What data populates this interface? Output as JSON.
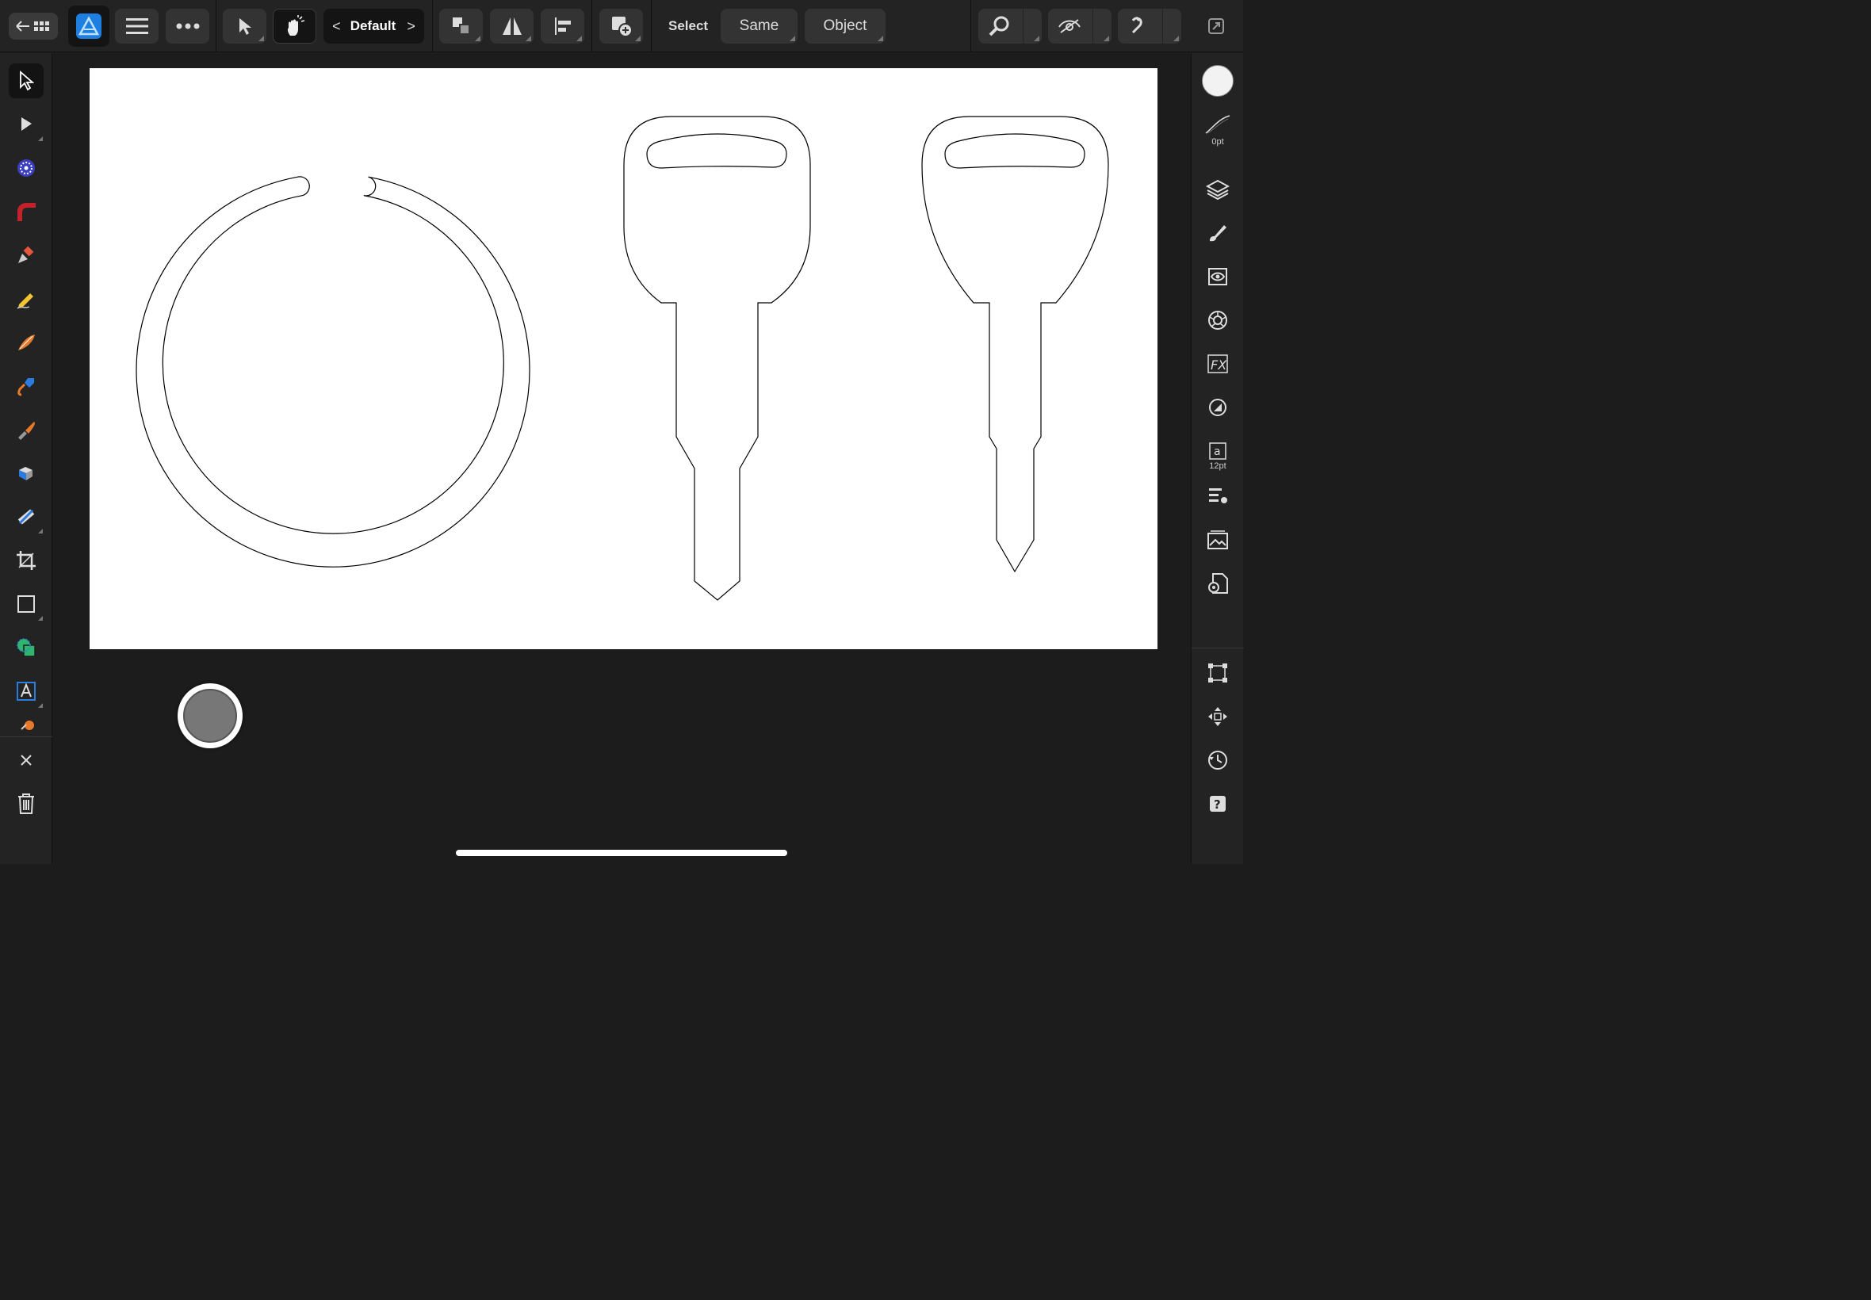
{
  "toolbar": {
    "persona": "Designer",
    "preset": {
      "label": "Default",
      "prev": "<",
      "next": ">"
    },
    "select_label": "Select",
    "same_label": "Same",
    "object_label": "Object"
  },
  "left_tools": [
    {
      "name": "move-tool-icon",
      "active": true
    },
    {
      "name": "node-tool-icon"
    },
    {
      "name": "point-transform-tool-icon"
    },
    {
      "name": "corner-tool-icon"
    },
    {
      "name": "pen-tool-icon"
    },
    {
      "name": "pencil-tool-icon"
    },
    {
      "name": "vector-brush-tool-icon"
    },
    {
      "name": "fill-tool-icon"
    },
    {
      "name": "knife-tool-icon"
    },
    {
      "name": "transparency-tool-icon"
    },
    {
      "name": "gradient-tool-icon"
    },
    {
      "name": "crop-tool-icon"
    },
    {
      "name": "rectangle-tool-icon"
    },
    {
      "name": "shape-builder-tool-icon"
    },
    {
      "name": "artistic-text-tool-icon"
    }
  ],
  "right_panel": {
    "stroke_width": "0pt",
    "text_size": "12pt"
  },
  "colors": {
    "accent": "#3b9bf5",
    "background": "#1c1c1c",
    "panel": "#232323"
  }
}
